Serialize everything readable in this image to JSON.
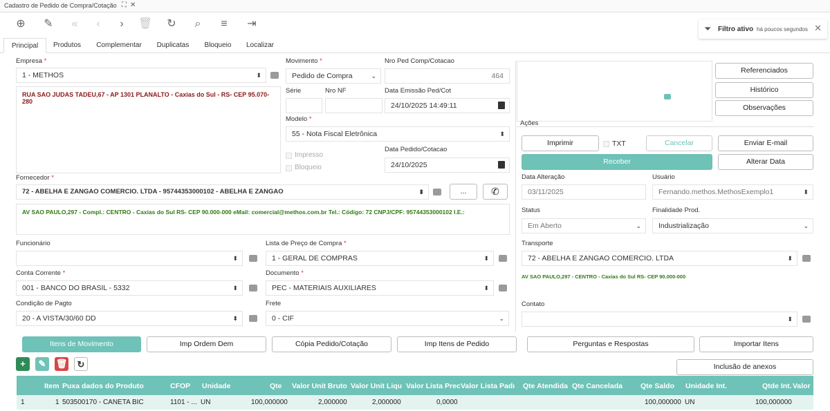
{
  "window": {
    "title": "Cadastro de Pedido de Compra/Cotação"
  },
  "filter": {
    "label": "Filtro ativo",
    "time": "há poucos segundos"
  },
  "tabs": [
    "Principal",
    "Produtos",
    "Complementar",
    "Duplicatas",
    "Bloqueio",
    "Localizar"
  ],
  "empresa": {
    "label": "Empresa",
    "value": "1 - METHOS",
    "address": "RUA SAO JUDAS TADEU,67 - AP 1301 PLANALTO - Caxias do Sul - RS- CEP 95.070-280"
  },
  "movimento": {
    "label": "Movimento",
    "value": "Pedido de Compra"
  },
  "nroped": {
    "label": "Nro Ped Comp/Cotacao",
    "value": "464"
  },
  "serie": {
    "label": "Série"
  },
  "nronf": {
    "label": "Nro NF"
  },
  "dataemissao": {
    "label": "Data Emissão Ped/Cot",
    "value": "24/10/2025 14:49:11"
  },
  "modelo": {
    "label": "Modelo",
    "value": "55 - Nota Fiscal Eletrônica"
  },
  "impresso": "Impresso",
  "bloqueio": "Bloqueio",
  "datapedido": {
    "label": "Data Pedido/Cotacao",
    "value": "24/10/2025"
  },
  "fornecedor": {
    "label": "Fornecedor",
    "value": "72 - ABELHA E ZANGAO COMERCIO. LTDA - 95744353000102 - ABELHA E ZANGAO",
    "details": "AV SAO PAULO,297        - Compl.:  CENTRO - Caxias do Sul RS- CEP 90.000-000 eMail: comercial@methos.com.br Tel.:  Código: 72 CNPJ/CPF: 95744353000102 I.E.:",
    "more": "..."
  },
  "funcionario": {
    "label": "Funcionário",
    "value": ""
  },
  "listapreco": {
    "label": "Lista de Preço de Compra",
    "value": "1 - GERAL DE COMPRAS"
  },
  "contacorrente": {
    "label": "Conta Corrente",
    "value": "001 - BANCO DO BRASIL - 5332"
  },
  "documento": {
    "label": "Documento",
    "value": "PEC - MATERIAIS AUXILIARES"
  },
  "condicao": {
    "label": "Condição de Pagto",
    "value": "20 - A VISTA/30/60 DD"
  },
  "frete": {
    "label": "Frete",
    "value": "0 - CIF"
  },
  "right": {
    "referenciados": "Referenciados",
    "historico": "Histórico",
    "observacoes": "Observações",
    "acoes": "Ações",
    "imprimir": "Imprimir",
    "txt": "TXT",
    "cancelar": "Cancelar",
    "enviar": "Enviar E-mail",
    "receber": "Receber",
    "alterar": "Alterar Data",
    "dataalt_label": "Data Alteração",
    "dataalt_value": "03/11/2025",
    "usuario_label": "Usuário",
    "usuario_value": "Fernando.methos.MethosExemplo1",
    "status_label": "Status",
    "status_value": "Em Aberto",
    "finalidade_label": "Finalidade Prod.",
    "finalidade_value": "Industrialização",
    "transporte_label": "Transporte",
    "transporte_value": "72 - ABELHA E ZANGAO COMERCIO. LTDA",
    "transporte_addr": "AV SAO PAULO,297        - CENTRO - Caxias do Sul RS- CEP 90.000-000",
    "contato_label": "Contato",
    "contato_value": ""
  },
  "actions": [
    "Itens de Movimento",
    "Imp Ordem Dem",
    "Cópia Pedido/Cotação",
    "Imp Itens de Pedido",
    "Perguntas e Respostas",
    "Importar Itens"
  ],
  "anexos": "Inclusão de anexos",
  "grid": {
    "headers": [
      "Item",
      "Puxa dados do Produto",
      "CFOP",
      "Unidade",
      "Qte",
      "Valor Unit Bruto",
      "Valor Unit Liqu",
      "Valor Lista Prec",
      "Valor Lista Padı",
      "Qte Atendida",
      "Qte Cancelada",
      "Qte Saldo",
      "Unidade Int.",
      "Qtde Int.",
      "Valor"
    ],
    "rows": [
      {
        "n": "1",
        "item": "1",
        "produto": "503500170 - CANETA BIC",
        "cfop": "1101 - ...",
        "unidade": "UN",
        "qte": "100,000000",
        "bruto": "2,000000",
        "liq": "2,000000",
        "lista": "0,0000",
        "saldo": "100,000000",
        "unint": "UN",
        "qtdeint": "100,000000"
      }
    ]
  },
  "colors": {
    "accent": "#6ec2b7",
    "required": "#dd3333"
  }
}
